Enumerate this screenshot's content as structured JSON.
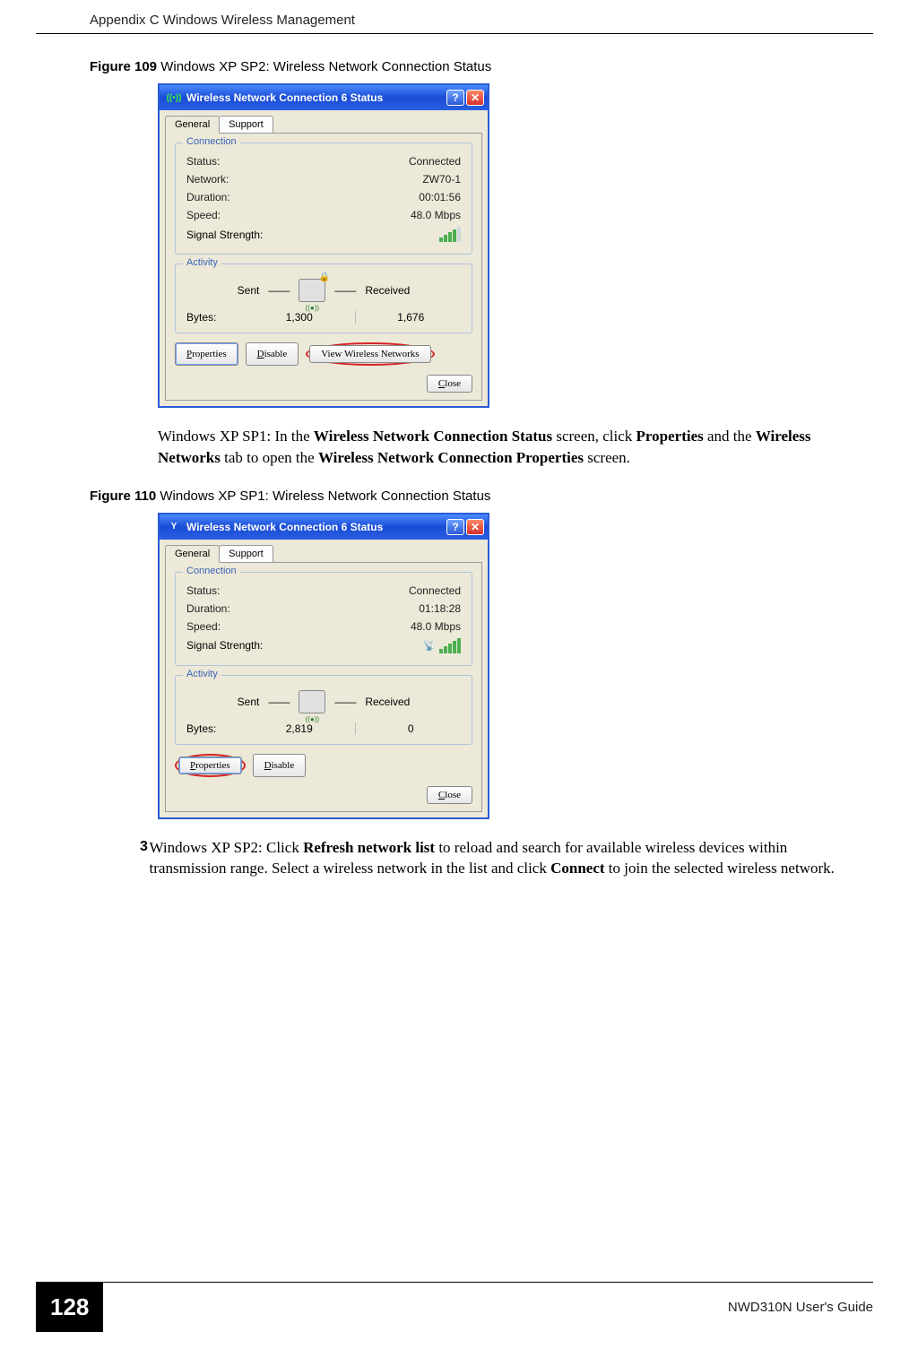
{
  "header": {
    "title": "Appendix C Windows Wireless Management"
  },
  "figure109": {
    "caption_bold": "Figure 109",
    "caption_rest": "   Windows XP SP2: Wireless Network Connection Status",
    "window_title": "Wireless Network Connection 6 Status",
    "tabs": {
      "general": "General",
      "support": "Support"
    },
    "group_connection": "Connection",
    "rows": {
      "status_label": "Status:",
      "status_value": "Connected",
      "network_label": "Network:",
      "network_value": "ZW70-1",
      "duration_label": "Duration:",
      "duration_value": "00:01:56",
      "speed_label": "Speed:",
      "speed_value": "48.0 Mbps",
      "signal_label": "Signal Strength:"
    },
    "group_activity": "Activity",
    "activity": {
      "sent": "Sent",
      "received": "Received",
      "bytes_label": "Bytes:",
      "bytes_sent": "1,300",
      "bytes_received": "1,676"
    },
    "buttons": {
      "properties": "Properties",
      "disable": "Disable",
      "view": "View Wireless Networks",
      "close": "Close"
    }
  },
  "para_sp1_intro_prefix": "Windows XP SP1: In the ",
  "para_sp1_b1": "Wireless Network Connection Status",
  "para_sp1_mid1": " screen, click ",
  "para_sp1_b2": "Properties",
  "para_sp1_mid2": " and the ",
  "para_sp1_b3": "Wireless Networks",
  "para_sp1_mid3": " tab to open the ",
  "para_sp1_b4": "Wireless Network Connection Properties",
  "para_sp1_suffix": " screen.",
  "figure110": {
    "caption_bold": "Figure 110",
    "caption_rest": "   Windows XP SP1: Wireless Network Connection Status",
    "window_title": "Wireless Network Connection 6 Status",
    "tabs": {
      "general": "General",
      "support": "Support"
    },
    "group_connection": "Connection",
    "rows": {
      "status_label": "Status:",
      "status_value": "Connected",
      "duration_label": "Duration:",
      "duration_value": "01:18:28",
      "speed_label": "Speed:",
      "speed_value": "48.0 Mbps",
      "signal_label": "Signal Strength:"
    },
    "group_activity": "Activity",
    "activity": {
      "sent": "Sent",
      "received": "Received",
      "bytes_label": "Bytes:",
      "bytes_sent": "2,819",
      "bytes_received": "0"
    },
    "buttons": {
      "properties": "Properties",
      "disable": "Disable",
      "close": "Close"
    }
  },
  "step3": {
    "num": "3",
    "t0": "Windows XP SP2: Click ",
    "b1": "Refresh network list",
    "t1": " to reload and search for available wireless devices within transmission range. Select a wireless network in the list and click ",
    "b2": "Connect",
    "t2": " to join the selected wireless network."
  },
  "footer": {
    "page": "128",
    "guide": "NWD310N User's Guide"
  }
}
